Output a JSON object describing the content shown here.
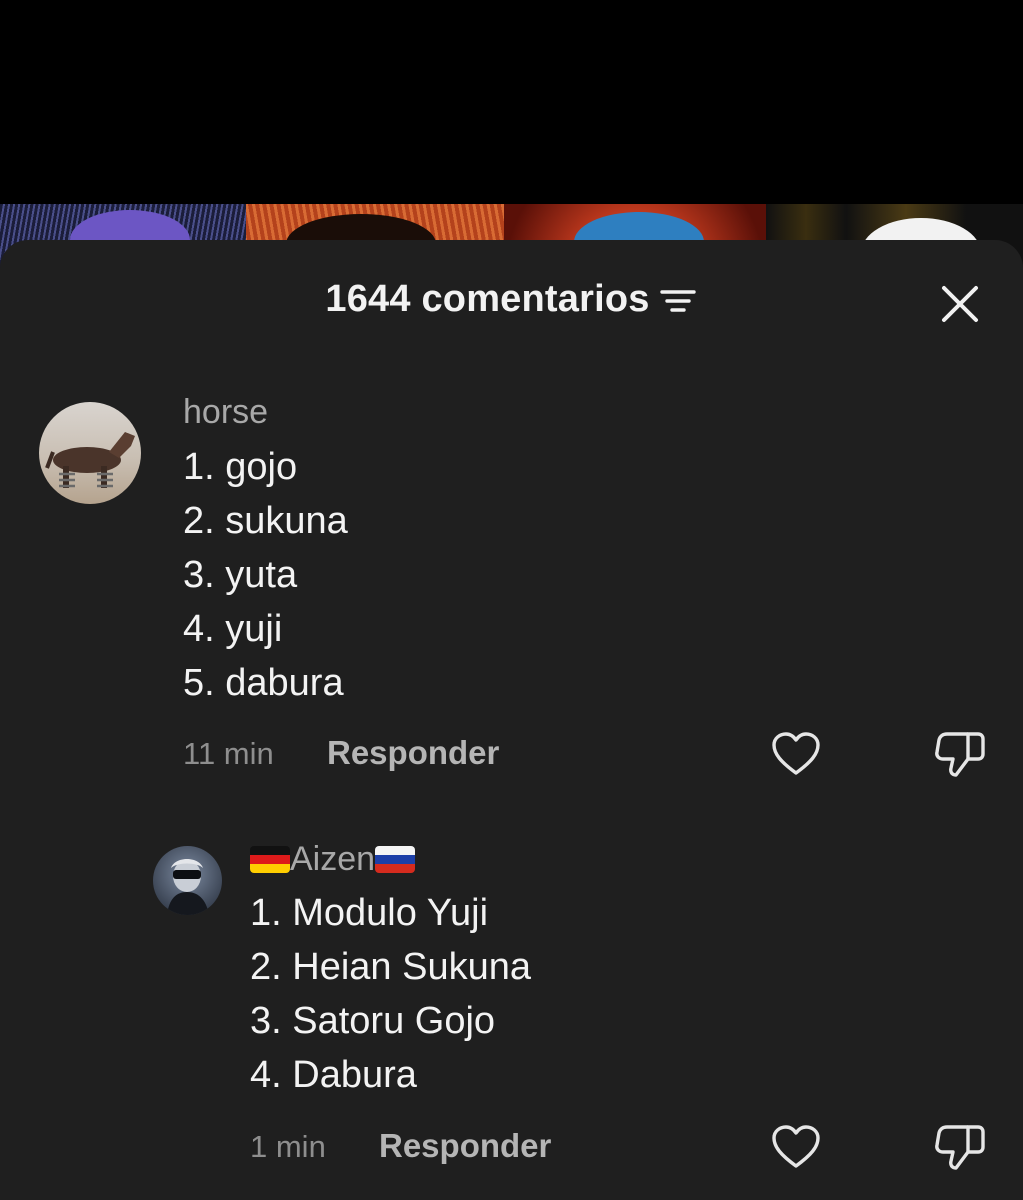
{
  "header": {
    "title": "1644 comentarios",
    "sort_icon": "sort-lines-icon",
    "close_icon": "close-icon"
  },
  "comments": [
    {
      "username": "horse",
      "lines": [
        "1. gojo",
        "2. sukuna",
        "3. yuta",
        "4. yuji",
        "5. dabura"
      ],
      "time": "11 min",
      "reply_label": "Responder",
      "like_icon": "heart-icon",
      "dislike_icon": "thumbs-down-icon"
    },
    {
      "username": "Aizen",
      "flag_left": "germany-flag-icon",
      "flag_right": "russia-flag-icon",
      "lines": [
        "1. Modulo Yuji",
        "2. Heian Sukuna",
        "3. Satoru Gojo",
        "4. Dabura"
      ],
      "time": "1 min",
      "reply_label": "Responder",
      "like_icon": "heart-icon",
      "dislike_icon": "thumbs-down-icon"
    }
  ],
  "colors": {
    "sheet_background": "#1f1f1f",
    "page_background": "#000000",
    "primary_text": "#f3f3f3",
    "secondary_text": "#a8a8a8"
  }
}
